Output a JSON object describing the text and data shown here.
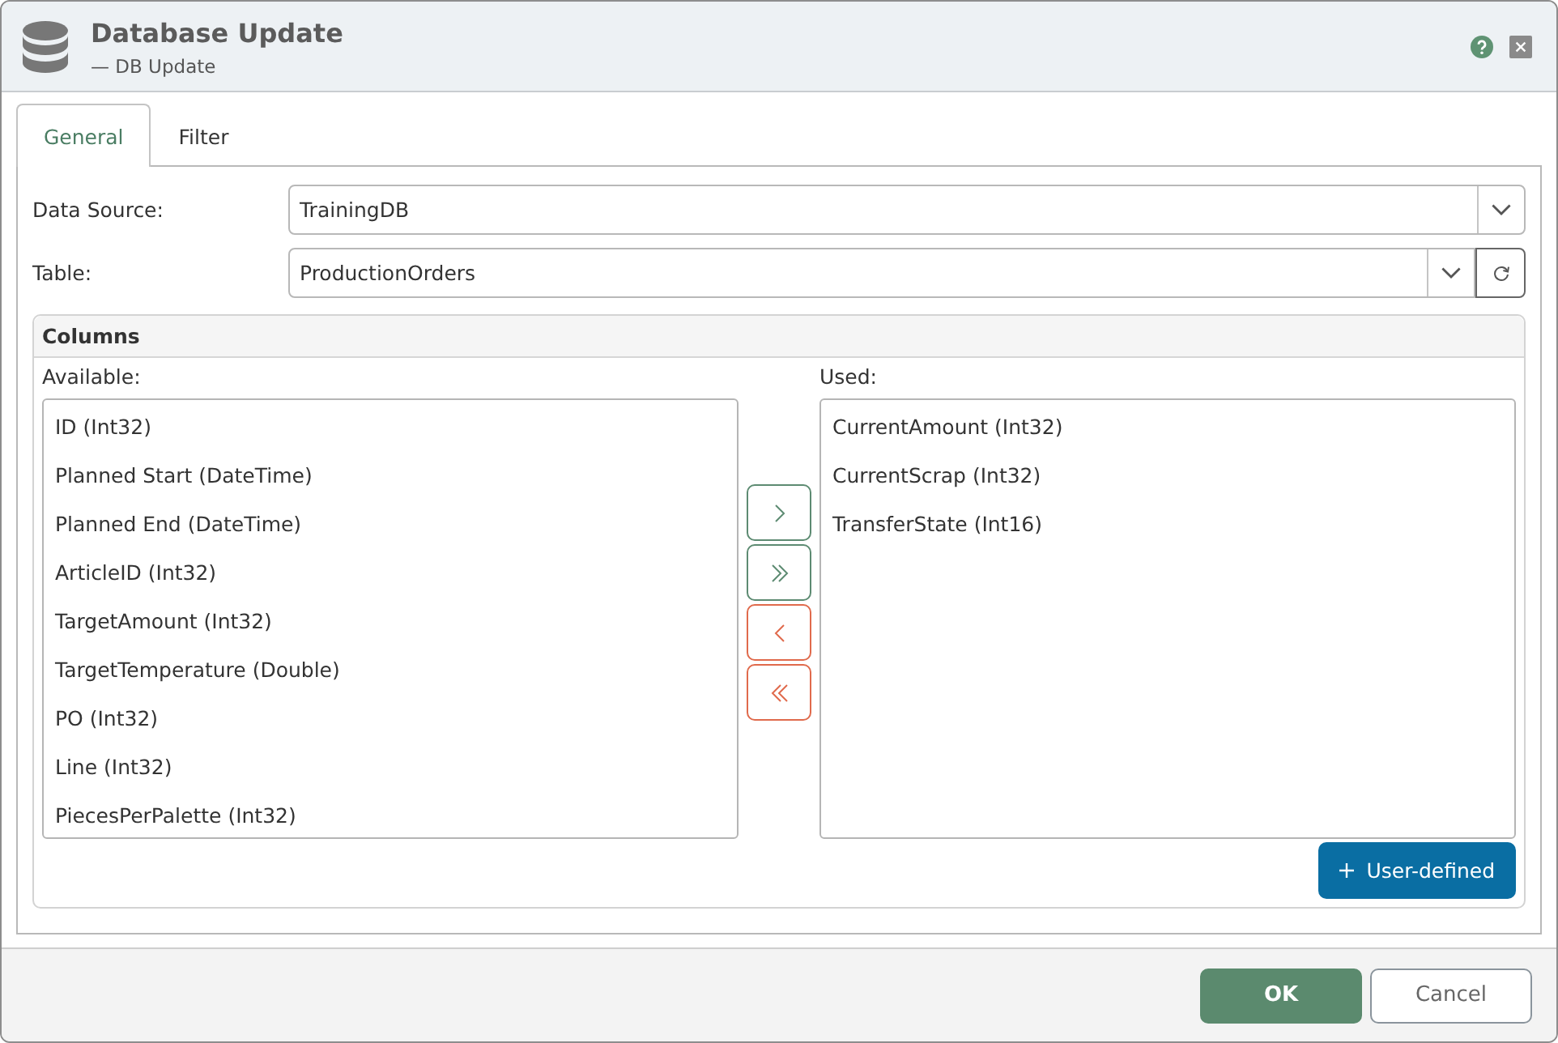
{
  "window": {
    "title": "Database Update",
    "subtitle": "— DB Update"
  },
  "tabs": [
    {
      "label": "General",
      "selected": true
    },
    {
      "label": "Filter",
      "selected": false
    }
  ],
  "fields": [
    {
      "label": "Data Source:",
      "value": "TrainingDB",
      "refresh": false
    },
    {
      "label": "Table:",
      "value": "ProductionOrders",
      "refresh": true
    }
  ],
  "columns": {
    "title": "Columns",
    "available": {
      "label": "Available:",
      "items": [
        {
          "label": "ID (Int32)",
          "selected": false
        },
        {
          "label": "Planned Start (DateTime)",
          "selected": false
        },
        {
          "label": "Planned End (DateTime)",
          "selected": false
        },
        {
          "label": "ArticleID (Int32)",
          "selected": false
        },
        {
          "label": "TargetAmount (Int32)",
          "selected": false
        },
        {
          "label": "TargetTemperature (Double)",
          "selected": false
        },
        {
          "label": "PO (Int32)",
          "selected": false
        },
        {
          "label": "Line (Int32)",
          "selected": false
        },
        {
          "label": "PiecesPerPalette (Int32)",
          "selected": false
        }
      ]
    },
    "transfer_buttons": [
      {
        "kind": "add"
      },
      {
        "kind": "add_all"
      },
      {
        "kind": "remove"
      },
      {
        "kind": "remove_all"
      }
    ],
    "used": {
      "label": "Used:",
      "items": [
        {
          "label": "CurrentAmount (Int32)",
          "selected": false
        },
        {
          "label": "CurrentScrap (Int32)",
          "selected": false
        },
        {
          "label": "TransferState (Int16)",
          "selected": false
        }
      ]
    },
    "user_defined_button": {
      "label": "User-defined"
    }
  },
  "buttons": [
    {
      "label": "OK",
      "kind": "primary"
    },
    {
      "label": "Cancel",
      "kind": "secondary"
    }
  ]
}
